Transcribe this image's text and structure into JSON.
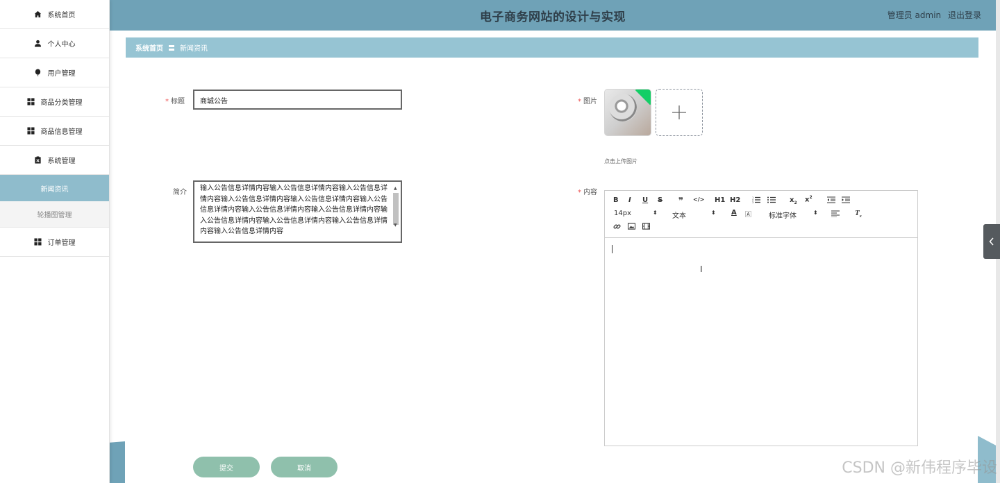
{
  "app": {
    "title": "电子商务网站的设计与实现",
    "user_prefix": "管理员 admin",
    "logout": "退出登录"
  },
  "sidebar": {
    "items": [
      {
        "label": "系统首页",
        "icon": "home-icon"
      },
      {
        "label": "个人中心",
        "icon": "user-icon"
      },
      {
        "label": "用户管理",
        "icon": "balloon-icon"
      },
      {
        "label": "商品分类管理",
        "icon": "grid-icon"
      },
      {
        "label": "商品信息管理",
        "icon": "grid-icon"
      },
      {
        "label": "系统管理",
        "icon": "clipboard-icon"
      }
    ],
    "sub_items": [
      {
        "label": "新闻资讯",
        "active": true
      },
      {
        "label": "轮播图管理",
        "active": false
      }
    ],
    "last_item": {
      "label": "订单管理",
      "icon": "grid-icon"
    }
  },
  "breadcrumb": {
    "home": "系统首页",
    "separator": "〓",
    "current": "新闻资讯"
  },
  "form": {
    "title_label": "标题",
    "title_value": "商城公告",
    "summary_label": "简介",
    "summary_value": "输入公告信息详情内容输入公告信息详情内容输入公告信息详情内容输入公告信息详情内容输入公告信息详情内容输入公告信息详情内容输入公告信息详情内容输入公告信息详情内容输入公告信息详情内容输入公告信息详情内容输入公告信息详情内容输入公告信息详情内容",
    "image_label": "图片",
    "upload_hint": "点击上传图片",
    "content_label": "内容",
    "required_mark": "*"
  },
  "editor": {
    "font_size": "14px",
    "heading_select": "文本",
    "font_family": "标准字体",
    "buttons": [
      "B",
      "I",
      "U",
      "S",
      "❞",
      "</>",
      "H1",
      "H2"
    ]
  },
  "actions": {
    "submit": "提交",
    "cancel": "取消"
  },
  "watermark": "CSDN @新伟程序毕设",
  "colors": {
    "header": "#6fa2b7",
    "breadcrumb": "#96c4d3",
    "active_nav": "#8fbccc",
    "button": "#8fc0ac",
    "required": "#ee5555"
  }
}
